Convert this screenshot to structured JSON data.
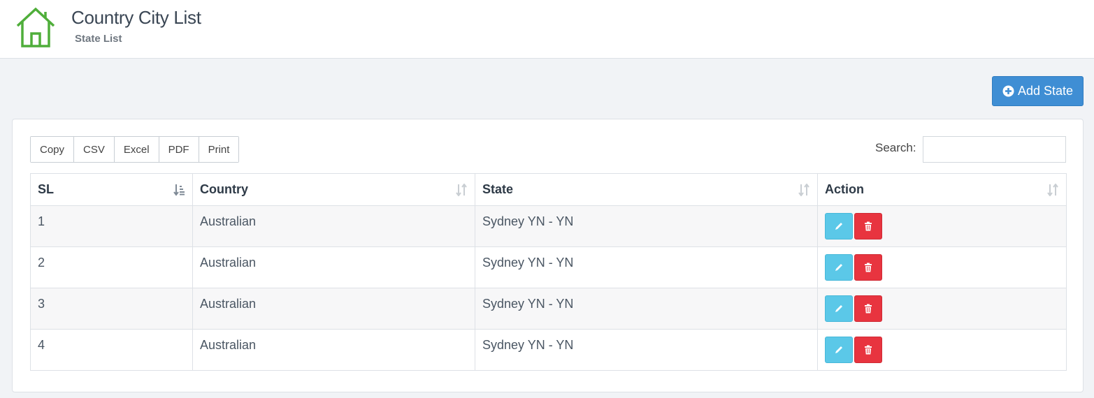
{
  "header": {
    "title": "Country City List",
    "subtitle": "State List",
    "icon": "home-icon",
    "accent_color": "#4fae3a"
  },
  "toolbar": {
    "add_label": "Add State",
    "add_color": "#3f8ed4"
  },
  "export_buttons": [
    "Copy",
    "CSV",
    "Excel",
    "PDF",
    "Print"
  ],
  "search": {
    "label": "Search:",
    "value": "",
    "placeholder": ""
  },
  "table": {
    "columns": [
      "SL",
      "Country",
      "State",
      "Action"
    ],
    "sorted_column": "SL",
    "rows": [
      {
        "sl": "1",
        "country": "Australian",
        "state": "Sydney YN - YN"
      },
      {
        "sl": "2",
        "country": "Australian",
        "state": "Sydney YN - YN"
      },
      {
        "sl": "3",
        "country": "Australian",
        "state": "Sydney YN - YN"
      },
      {
        "sl": "4",
        "country": "Australian",
        "state": "Sydney YN - YN"
      }
    ],
    "row_actions": {
      "edit_icon": "pencil-icon",
      "delete_icon": "trash-icon",
      "edit_color": "#5bc8e8",
      "delete_color": "#e8343f"
    }
  }
}
